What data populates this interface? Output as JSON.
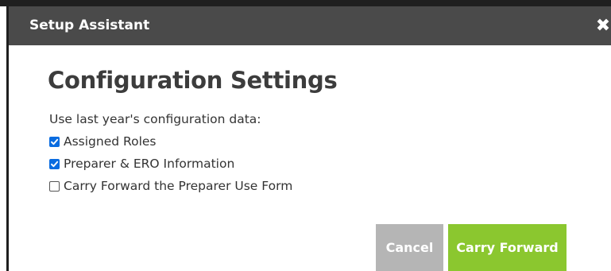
{
  "dialog": {
    "title": "Setup Assistant",
    "close_icon": "close-icon"
  },
  "content": {
    "heading": "Configuration Settings",
    "intro": "Use last year's configuration data:",
    "options": [
      {
        "label": "Assigned Roles",
        "checked": true
      },
      {
        "label": "Preparer & ERO Information",
        "checked": true
      },
      {
        "label": "Carry Forward the Preparer Use Form",
        "checked": false
      }
    ]
  },
  "buttons": {
    "cancel": "Cancel",
    "carry_forward": "Carry Forward"
  },
  "colors": {
    "titlebar": "#4a4a4a",
    "checkbox_checked": "#0a6ce0",
    "cancel_button": "#b5b5b5",
    "carry_forward_button": "#8bc72f"
  }
}
